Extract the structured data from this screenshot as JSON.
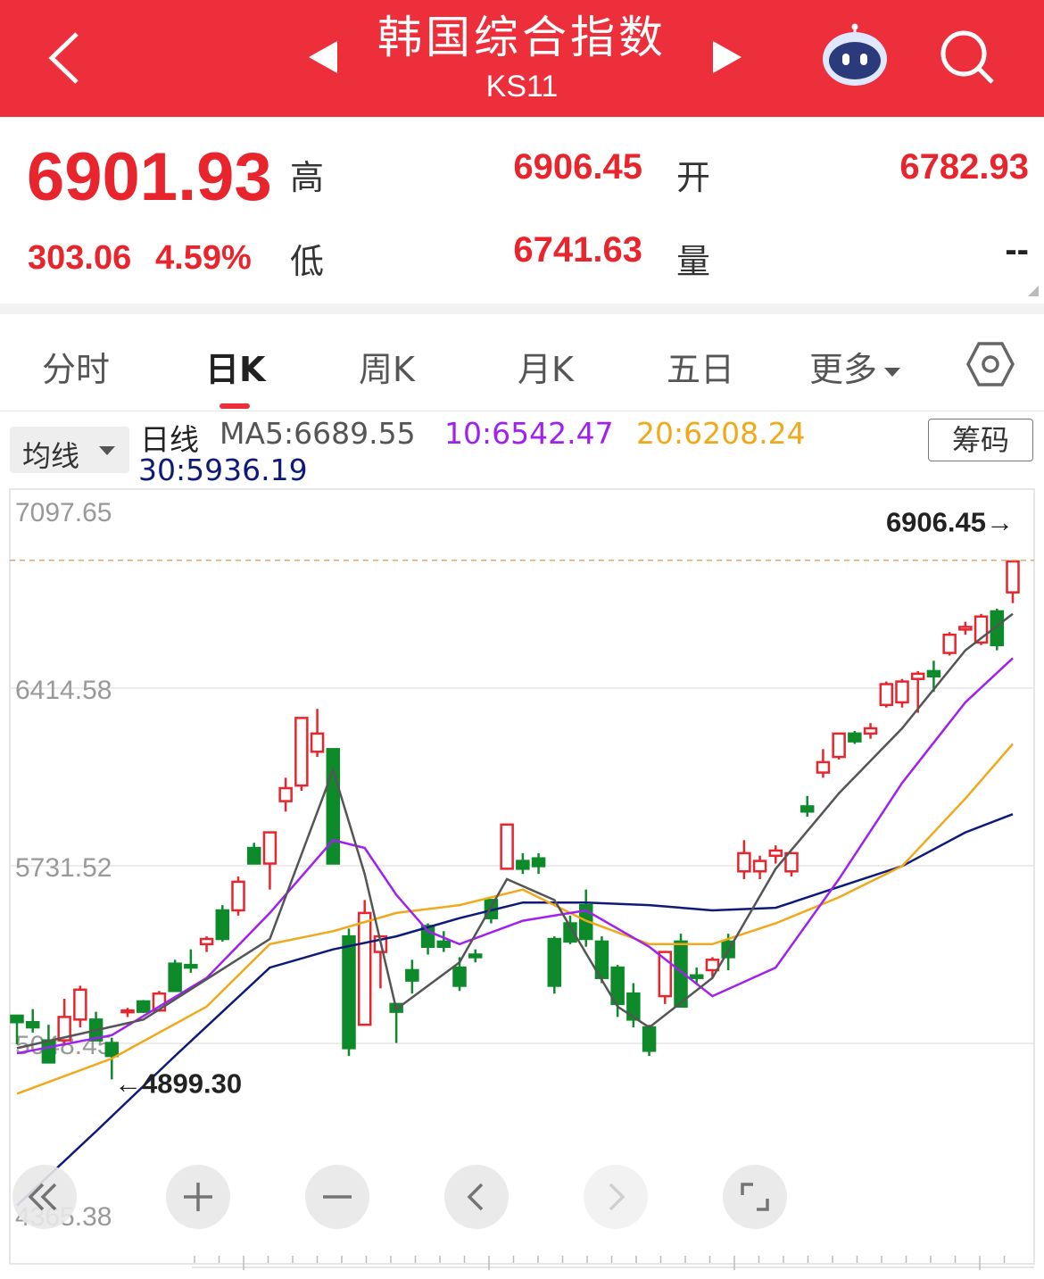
{
  "header": {
    "title": "韩国综合指数",
    "code": "KS11"
  },
  "quote": {
    "price": "6901.93",
    "change": "303.06",
    "change_pct": "4.59%",
    "high_label": "高",
    "high": "6906.45",
    "low_label": "低",
    "low": "6741.63",
    "open_label": "开",
    "open": "6782.93",
    "volume_label": "量",
    "volume": "--"
  },
  "tabs": [
    "分时",
    "日K",
    "周K",
    "月K",
    "五日",
    "更多"
  ],
  "active_tab": "日K",
  "indicator": {
    "avg_label": "均线",
    "period_label": "日线",
    "ma5": "MA5:6689.55",
    "ma10": "10:6542.47",
    "ma20": "20:6208.24",
    "ma30": "30:5936.19",
    "chip_button": "筹码"
  },
  "colors": {
    "header": "#ed2f3b",
    "up": "#e8242c",
    "down": "#0d8a2a",
    "ma5": "#555555",
    "ma10": "#a020f0",
    "ma20": "#f0a91b",
    "ma30": "#0e1a7a"
  },
  "chart_data": {
    "type": "candlestick",
    "y_tick_labels": [
      "7097.65",
      "6414.58",
      "5731.52",
      "5048.45",
      "4365.38"
    ],
    "ylim": [
      4365.38,
      7097.65
    ],
    "max_label": "6906.45→",
    "min_label": "←4899.30",
    "candles": [
      {
        "o": 5155,
        "h": 5155,
        "l": 5045,
        "c": 5130
      },
      {
        "o": 5130,
        "h": 5180,
        "l": 5090,
        "c": 5110
      },
      {
        "o": 5060,
        "h": 5120,
        "l": 5000,
        "c": 4975
      },
      {
        "o": 5060,
        "h": 5220,
        "l": 5040,
        "c": 5150
      },
      {
        "o": 5140,
        "h": 5270,
        "l": 5110,
        "c": 5255
      },
      {
        "o": 5140,
        "h": 5170,
        "l": 5070,
        "c": 5060
      },
      {
        "o": 5050,
        "h": 5070,
        "l": 4910,
        "c": 5000
      },
      {
        "o": 5170,
        "h": 5185,
        "l": 5150,
        "c": 5175
      },
      {
        "o": 5210,
        "h": 5215,
        "l": 5165,
        "c": 5170
      },
      {
        "o": 5175,
        "h": 5250,
        "l": 5170,
        "c": 5240
      },
      {
        "o": 5355,
        "h": 5370,
        "l": 5260,
        "c": 5250
      },
      {
        "o": 5350,
        "h": 5410,
        "l": 5320,
        "c": 5340
      },
      {
        "o": 5430,
        "h": 5460,
        "l": 5400,
        "c": 5450
      },
      {
        "o": 5560,
        "h": 5580,
        "l": 5440,
        "c": 5450
      },
      {
        "o": 5560,
        "h": 5690,
        "l": 5540,
        "c": 5670
      },
      {
        "o": 5800,
        "h": 5820,
        "l": 5760,
        "c": 5740
      },
      {
        "o": 5740,
        "h": 5810,
        "l": 5640,
        "c": 5860
      },
      {
        "o": 5980,
        "h": 6070,
        "l": 5940,
        "c": 6030
      },
      {
        "o": 6040,
        "h": 6300,
        "l": 6020,
        "c": 6300
      },
      {
        "o": 6170,
        "h": 6335,
        "l": 6150,
        "c": 6240
      },
      {
        "o": 6180,
        "h": 6180,
        "l": 5740,
        "c": 5740
      },
      {
        "o": 5460,
        "h": 5490,
        "l": 5000,
        "c": 5030
      },
      {
        "o": 5120,
        "h": 5600,
        "l": 5120,
        "c": 5550
      },
      {
        "o": 5400,
        "h": 5440,
        "l": 5260,
        "c": 5460
      },
      {
        "o": 5200,
        "h": 5200,
        "l": 5050,
        "c": 5170
      },
      {
        "o": 5330,
        "h": 5370,
        "l": 5240,
        "c": 5290
      },
      {
        "o": 5500,
        "h": 5510,
        "l": 5390,
        "c": 5420
      },
      {
        "o": 5440,
        "h": 5480,
        "l": 5400,
        "c": 5420
      },
      {
        "o": 5340,
        "h": 5380,
        "l": 5250,
        "c": 5270
      },
      {
        "o": 5390,
        "h": 5410,
        "l": 5360,
        "c": 5380
      },
      {
        "o": 5600,
        "h": 5600,
        "l": 5510,
        "c": 5530
      },
      {
        "o": 5720,
        "h": 5820,
        "l": 5720,
        "c": 5890
      },
      {
        "o": 5750,
        "h": 5780,
        "l": 5700,
        "c": 5720
      },
      {
        "o": 5760,
        "h": 5780,
        "l": 5700,
        "c": 5730
      },
      {
        "o": 5450,
        "h": 5460,
        "l": 5240,
        "c": 5270
      },
      {
        "o": 5510,
        "h": 5540,
        "l": 5430,
        "c": 5440
      },
      {
        "o": 5580,
        "h": 5640,
        "l": 5420,
        "c": 5450
      },
      {
        "o": 5440,
        "h": 5460,
        "l": 5280,
        "c": 5300
      },
      {
        "o": 5340,
        "h": 5350,
        "l": 5150,
        "c": 5200
      },
      {
        "o": 5240,
        "h": 5280,
        "l": 5110,
        "c": 5140
      },
      {
        "o": 5110,
        "h": 5120,
        "l": 5000,
        "c": 5020
      },
      {
        "o": 5230,
        "h": 5400,
        "l": 5200,
        "c": 5400
      },
      {
        "o": 5440,
        "h": 5470,
        "l": 5300,
        "c": 5190
      },
      {
        "o": 5310,
        "h": 5340,
        "l": 5280,
        "c": 5300
      },
      {
        "o": 5330,
        "h": 5380,
        "l": 5300,
        "c": 5370
      },
      {
        "o": 5440,
        "h": 5470,
        "l": 5330,
        "c": 5380
      },
      {
        "o": 5710,
        "h": 5830,
        "l": 5680,
        "c": 5780
      },
      {
        "o": 5710,
        "h": 5770,
        "l": 5680,
        "c": 5750
      },
      {
        "o": 5770,
        "h": 5810,
        "l": 5740,
        "c": 5790
      },
      {
        "o": 5710,
        "h": 5780,
        "l": 5690,
        "c": 5780
      },
      {
        "o": 5960,
        "h": 6000,
        "l": 5920,
        "c": 5940
      },
      {
        "o": 6090,
        "h": 6180,
        "l": 6070,
        "c": 6130
      },
      {
        "o": 6150,
        "h": 6240,
        "l": 6140,
        "c": 6240
      },
      {
        "o": 6240,
        "h": 6250,
        "l": 6200,
        "c": 6210
      },
      {
        "o": 6240,
        "h": 6280,
        "l": 6220,
        "c": 6260
      },
      {
        "o": 6350,
        "h": 6440,
        "l": 6340,
        "c": 6430
      },
      {
        "o": 6360,
        "h": 6450,
        "l": 6340,
        "c": 6440
      },
      {
        "o": 6450,
        "h": 6480,
        "l": 6320,
        "c": 6470
      },
      {
        "o": 6480,
        "h": 6520,
        "l": 6400,
        "c": 6460
      },
      {
        "o": 6550,
        "h": 6630,
        "l": 6540,
        "c": 6620
      },
      {
        "o": 6640,
        "h": 6670,
        "l": 6620,
        "c": 6650
      },
      {
        "o": 6590,
        "h": 6700,
        "l": 6580,
        "c": 6690
      },
      {
        "o": 6710,
        "h": 6720,
        "l": 6560,
        "c": 6580
      },
      {
        "o": 6782.93,
        "h": 6906.45,
        "l": 6741.63,
        "c": 6901.93
      }
    ],
    "ma5": [
      [
        0,
        5030
      ],
      [
        8,
        5140
      ],
      [
        16,
        5450
      ],
      [
        20,
        6100
      ],
      [
        22,
        5700
      ],
      [
        24,
        5180
      ],
      [
        28,
        5360
      ],
      [
        31,
        5680
      ],
      [
        34,
        5600
      ],
      [
        38,
        5190
      ],
      [
        40,
        5110
      ],
      [
        44,
        5300
      ],
      [
        48,
        5720
      ],
      [
        52,
        6010
      ],
      [
        56,
        6260
      ],
      [
        60,
        6560
      ],
      [
        63,
        6700
      ]
    ],
    "ma10": [
      [
        0,
        5010
      ],
      [
        6,
        5080
      ],
      [
        12,
        5300
      ],
      [
        16,
        5550
      ],
      [
        20,
        5830
      ],
      [
        22,
        5800
      ],
      [
        24,
        5620
      ],
      [
        26,
        5480
      ],
      [
        28,
        5430
      ],
      [
        32,
        5520
      ],
      [
        36,
        5560
      ],
      [
        40,
        5420
      ],
      [
        44,
        5230
      ],
      [
        48,
        5340
      ],
      [
        52,
        5680
      ],
      [
        56,
        6050
      ],
      [
        60,
        6360
      ],
      [
        63,
        6530
      ]
    ],
    "ma20": [
      [
        0,
        4855
      ],
      [
        6,
        4990
      ],
      [
        12,
        5190
      ],
      [
        16,
        5430
      ],
      [
        20,
        5480
      ],
      [
        24,
        5550
      ],
      [
        28,
        5580
      ],
      [
        32,
        5640
      ],
      [
        36,
        5520
      ],
      [
        40,
        5430
      ],
      [
        44,
        5430
      ],
      [
        48,
        5510
      ],
      [
        52,
        5610
      ],
      [
        56,
        5730
      ],
      [
        60,
        5990
      ],
      [
        63,
        6200
      ]
    ],
    "ma30": [
      [
        0,
        4425
      ],
      [
        5,
        4710
      ],
      [
        10,
        5000
      ],
      [
        16,
        5340
      ],
      [
        20,
        5410
      ],
      [
        24,
        5460
      ],
      [
        28,
        5530
      ],
      [
        32,
        5590
      ],
      [
        36,
        5590
      ],
      [
        40,
        5580
      ],
      [
        44,
        5560
      ],
      [
        48,
        5570
      ],
      [
        52,
        5650
      ],
      [
        56,
        5730
      ],
      [
        60,
        5860
      ],
      [
        63,
        5930
      ]
    ]
  }
}
